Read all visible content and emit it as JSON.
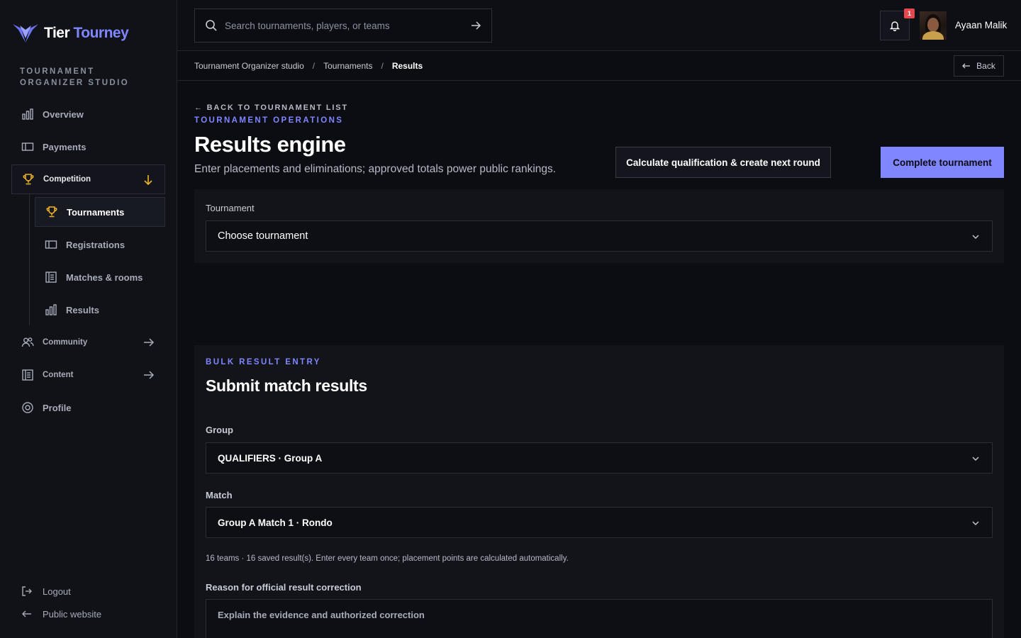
{
  "brand": {
    "word1": "Tier",
    "word2": "Tourney",
    "accent": "#7f86ff"
  },
  "sidebar": {
    "section_label": "TOURNAMENT ORGANIZER STUDIO",
    "items": [
      {
        "label": "Overview",
        "icon": "bar-chart-icon"
      },
      {
        "label": "Payments",
        "icon": "ticket-icon"
      },
      {
        "label": "Competition",
        "icon": "trophy-icon",
        "expanded": true
      },
      {
        "label": "Community",
        "icon": "users-icon"
      },
      {
        "label": "Content",
        "icon": "document-icon"
      },
      {
        "label": "Profile",
        "icon": "settings-icon"
      }
    ],
    "sub_items": [
      {
        "label": "Tournaments",
        "icon": "trophy-icon",
        "active": true
      },
      {
        "label": "Registrations",
        "icon": "ticket-icon"
      },
      {
        "label": "Matches & rooms",
        "icon": "document-icon"
      },
      {
        "label": "Results",
        "icon": "bar-chart-icon"
      }
    ],
    "footer": {
      "logout": "Logout",
      "public_website": "Public website"
    }
  },
  "topbar": {
    "search_placeholder": "Search tournaments, players, or teams",
    "notification_count": "1",
    "user_name": "Ayaan Malik"
  },
  "breadcrumb": {
    "items": [
      "Tournament Organizer studio",
      "Tournaments",
      "Results"
    ],
    "back_label": "Back"
  },
  "main": {
    "back_link": "← BACK TO TOURNAMENT LIST",
    "eyebrow": "TOURNAMENT OPERATIONS",
    "title": "Results engine",
    "subtitle": "Enter placements and eliminations; approved totals power public rankings.",
    "calc_button": "Calculate qualification & create next round",
    "complete_button": "Complete tournament",
    "tournament_label": "Tournament",
    "tournament_value": "Choose tournament"
  },
  "bulk": {
    "eyebrow": "BULK RESULT ENTRY",
    "title": "Submit match results",
    "group_label": "Group",
    "group_value": "QUALIFIERS · Group A",
    "match_label": "Match",
    "match_value": "Group A Match 1 · Rondo",
    "info": "16 teams · 16 saved result(s). Enter every team once; placement points are calculated automatically.",
    "reason_label": "Reason for official result correction",
    "reason_placeholder": "Explain the evidence and authorized correction"
  }
}
